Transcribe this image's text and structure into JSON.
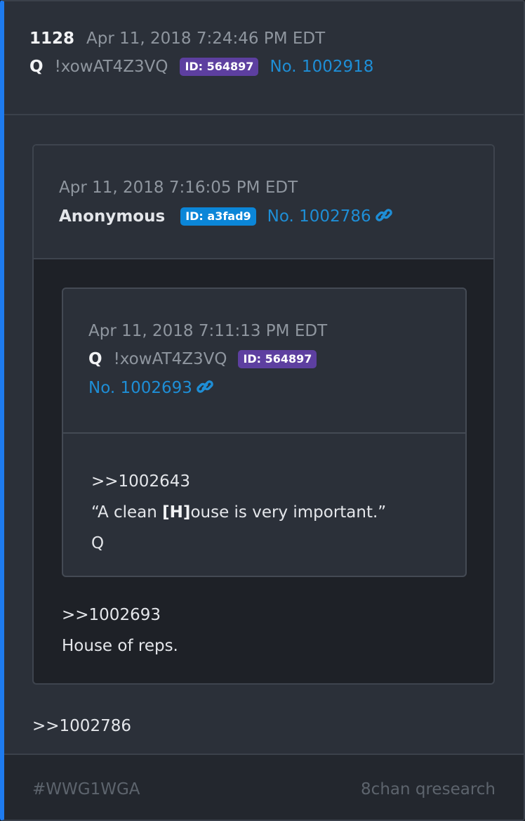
{
  "post": {
    "number": "1128",
    "date": "Apr 11, 2018 7:24:46 PM EDT",
    "name": "Q",
    "tripcode": "!xowAT4Z3VQ",
    "id_badge": "ID: 564897",
    "post_no": "No. 1002918",
    "body_lines": [
      ">>1002786"
    ]
  },
  "quote1": {
    "date": "Apr 11, 2018 7:16:05 PM EDT",
    "name": "Anonymous",
    "id_badge": "ID: a3fad9",
    "post_no": "No. 1002786",
    "body_lines": [
      ">>1002693",
      "House of reps."
    ]
  },
  "quote2": {
    "date": "Apr 11, 2018 7:11:13 PM EDT",
    "name": "Q",
    "tripcode": "!xowAT4Z3VQ",
    "id_badge": "ID: 564897",
    "post_no": "No. 1002693",
    "body_line1": ">>1002643",
    "body_line2_pre": "“A clean ",
    "body_line2_bold": "[H]",
    "body_line2_post": "ouse is very important.”",
    "body_line3": "Q"
  },
  "footer": {
    "hashtag": "#WWG1WGA",
    "source": "8chan qresearch"
  },
  "colors": {
    "accent_bar": "#1e7bef",
    "link": "#1e8ed6",
    "badge_purple": "#5d3fa0",
    "badge_blue": "#0b86d8"
  },
  "icons": [
    "link-icon"
  ]
}
